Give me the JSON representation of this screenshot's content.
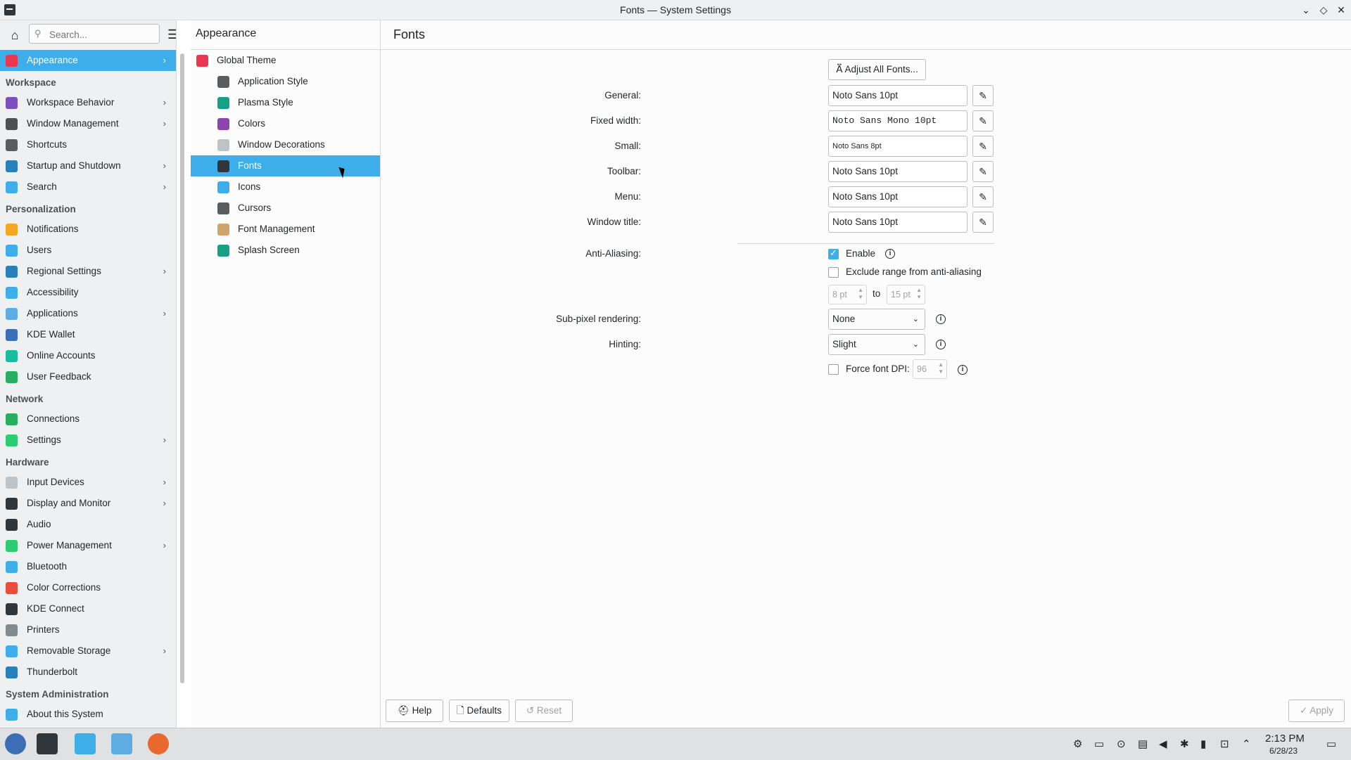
{
  "window": {
    "title": "Fonts — System Settings"
  },
  "sidebar": {
    "search_placeholder": "Search...",
    "items": [
      {
        "label": "Appearance",
        "type": "item",
        "selected": true,
        "chevron": true,
        "icon": "appearance-icon",
        "color": "#e8384f"
      },
      {
        "label": "Workspace",
        "type": "header"
      },
      {
        "label": "Workspace Behavior",
        "type": "item",
        "chevron": true,
        "icon": "workspace-behavior-icon",
        "color": "#7b4fbe"
      },
      {
        "label": "Window Management",
        "type": "item",
        "chevron": true,
        "icon": "window-management-icon",
        "color": "#4d4f52"
      },
      {
        "label": "Shortcuts",
        "type": "item",
        "icon": "keyboard-icon",
        "color": "#5a5c5e"
      },
      {
        "label": "Startup and Shutdown",
        "type": "item",
        "chevron": true,
        "icon": "startup-icon",
        "color": "#2980b9"
      },
      {
        "label": "Search",
        "type": "item",
        "chevron": true,
        "icon": "search-icon",
        "color": "#3daee9"
      },
      {
        "label": "Personalization",
        "type": "header"
      },
      {
        "label": "Notifications",
        "type": "item",
        "icon": "bell-icon",
        "color": "#f5a623"
      },
      {
        "label": "Users",
        "type": "item",
        "icon": "users-icon",
        "color": "#3daee9"
      },
      {
        "label": "Regional Settings",
        "type": "item",
        "chevron": true,
        "icon": "regional-icon",
        "color": "#2980b9"
      },
      {
        "label": "Accessibility",
        "type": "item",
        "icon": "accessibility-icon",
        "color": "#3daee9"
      },
      {
        "label": "Applications",
        "type": "item",
        "chevron": true,
        "icon": "applications-icon",
        "color": "#5dade2"
      },
      {
        "label": "KDE Wallet",
        "type": "item",
        "icon": "wallet-icon",
        "color": "#3b6fb6"
      },
      {
        "label": "Online Accounts",
        "type": "item",
        "icon": "online-accounts-icon",
        "color": "#1abc9c"
      },
      {
        "label": "User Feedback",
        "type": "item",
        "icon": "feedback-icon",
        "color": "#27ae60"
      },
      {
        "label": "Network",
        "type": "header"
      },
      {
        "label": "Connections",
        "type": "item",
        "icon": "globe-icon",
        "color": "#27ae60"
      },
      {
        "label": "Settings",
        "type": "item",
        "chevron": true,
        "icon": "network-settings-icon",
        "color": "#2ecc71"
      },
      {
        "label": "Hardware",
        "type": "header"
      },
      {
        "label": "Input Devices",
        "type": "item",
        "chevron": true,
        "icon": "mouse-icon",
        "color": "#bdc3c7"
      },
      {
        "label": "Display and Monitor",
        "type": "item",
        "chevron": true,
        "icon": "monitor-icon",
        "color": "#31363b"
      },
      {
        "label": "Audio",
        "type": "item",
        "icon": "speaker-icon",
        "color": "#31363b"
      },
      {
        "label": "Power Management",
        "type": "item",
        "chevron": true,
        "icon": "power-icon",
        "color": "#2ecc71"
      },
      {
        "label": "Bluetooth",
        "type": "item",
        "icon": "bluetooth-icon",
        "color": "#3daee9"
      },
      {
        "label": "Color Corrections",
        "type": "item",
        "icon": "color-correction-icon",
        "color": "#e74c3c"
      },
      {
        "label": "KDE Connect",
        "type": "item",
        "icon": "phone-icon",
        "color": "#31363b"
      },
      {
        "label": "Printers",
        "type": "item",
        "icon": "printer-icon",
        "color": "#7f8c8d"
      },
      {
        "label": "Removable Storage",
        "type": "item",
        "chevron": true,
        "icon": "usb-icon",
        "color": "#3daee9"
      },
      {
        "label": "Thunderbolt",
        "type": "item",
        "icon": "thunderbolt-icon",
        "color": "#2980b9"
      },
      {
        "label": "System Administration",
        "type": "header"
      },
      {
        "label": "About this System",
        "type": "item",
        "icon": "info-icon",
        "color": "#3daee9"
      }
    ]
  },
  "middle": {
    "title": "Appearance",
    "items": [
      {
        "label": "Global Theme",
        "level": 0,
        "icon": "global-theme-icon",
        "color": "#e8384f"
      },
      {
        "label": "Application Style",
        "level": 1,
        "icon": "application-style-icon",
        "color": "#5a5c5e"
      },
      {
        "label": "Plasma Style",
        "level": 1,
        "icon": "plasma-style-icon",
        "color": "#16a085"
      },
      {
        "label": "Colors",
        "level": 1,
        "icon": "colors-icon",
        "color": "#8e44ad"
      },
      {
        "label": "Window Decorations",
        "level": 1,
        "icon": "window-decorations-icon",
        "color": "#bdc3c7"
      },
      {
        "label": "Fonts",
        "level": 1,
        "selected": true,
        "icon": "fonts-icon",
        "color": "#31363b"
      },
      {
        "label": "Icons",
        "level": 1,
        "icon": "icons-icon",
        "color": "#3daee9"
      },
      {
        "label": "Cursors",
        "level": 1,
        "icon": "cursors-icon",
        "color": "#5a5c5e"
      },
      {
        "label": "Font Management",
        "level": 1,
        "icon": "font-management-icon",
        "color": "#d0a56b"
      },
      {
        "label": "Splash Screen",
        "level": 1,
        "icon": "splash-screen-icon",
        "color": "#16a085"
      }
    ]
  },
  "content": {
    "title": "Fonts",
    "adjust_all": "Adjust All Fonts...",
    "fonts": [
      {
        "label": "General:",
        "value": "Noto Sans 10pt"
      },
      {
        "label": "Fixed width:",
        "value": "Noto Sans Mono 10pt"
      },
      {
        "label": "Small:",
        "value": "Noto Sans 8pt"
      },
      {
        "label": "Toolbar:",
        "value": "Noto Sans 10pt"
      },
      {
        "label": "Menu:",
        "value": "Noto Sans 10pt"
      },
      {
        "label": "Window title:",
        "value": "Noto Sans 10pt"
      }
    ],
    "anti_aliasing": {
      "label": "Anti-Aliasing:",
      "enable_label": "Enable",
      "enabled": true
    },
    "exclude": {
      "label": "Exclude range from anti-aliasing",
      "checked": false,
      "from": "8 pt",
      "to_label": "to",
      "to": "15 pt"
    },
    "subpixel": {
      "label": "Sub-pixel rendering:",
      "value": "None"
    },
    "hinting": {
      "label": "Hinting:",
      "value": "Slight"
    },
    "force_dpi": {
      "label": "Force font DPI:",
      "checked": false,
      "value": "96"
    }
  },
  "footer": {
    "help": "Help",
    "defaults": "Defaults",
    "reset": "Reset",
    "apply": "Apply"
  },
  "taskbar": {
    "time": "2:13 PM",
    "date": "6/28/23"
  }
}
